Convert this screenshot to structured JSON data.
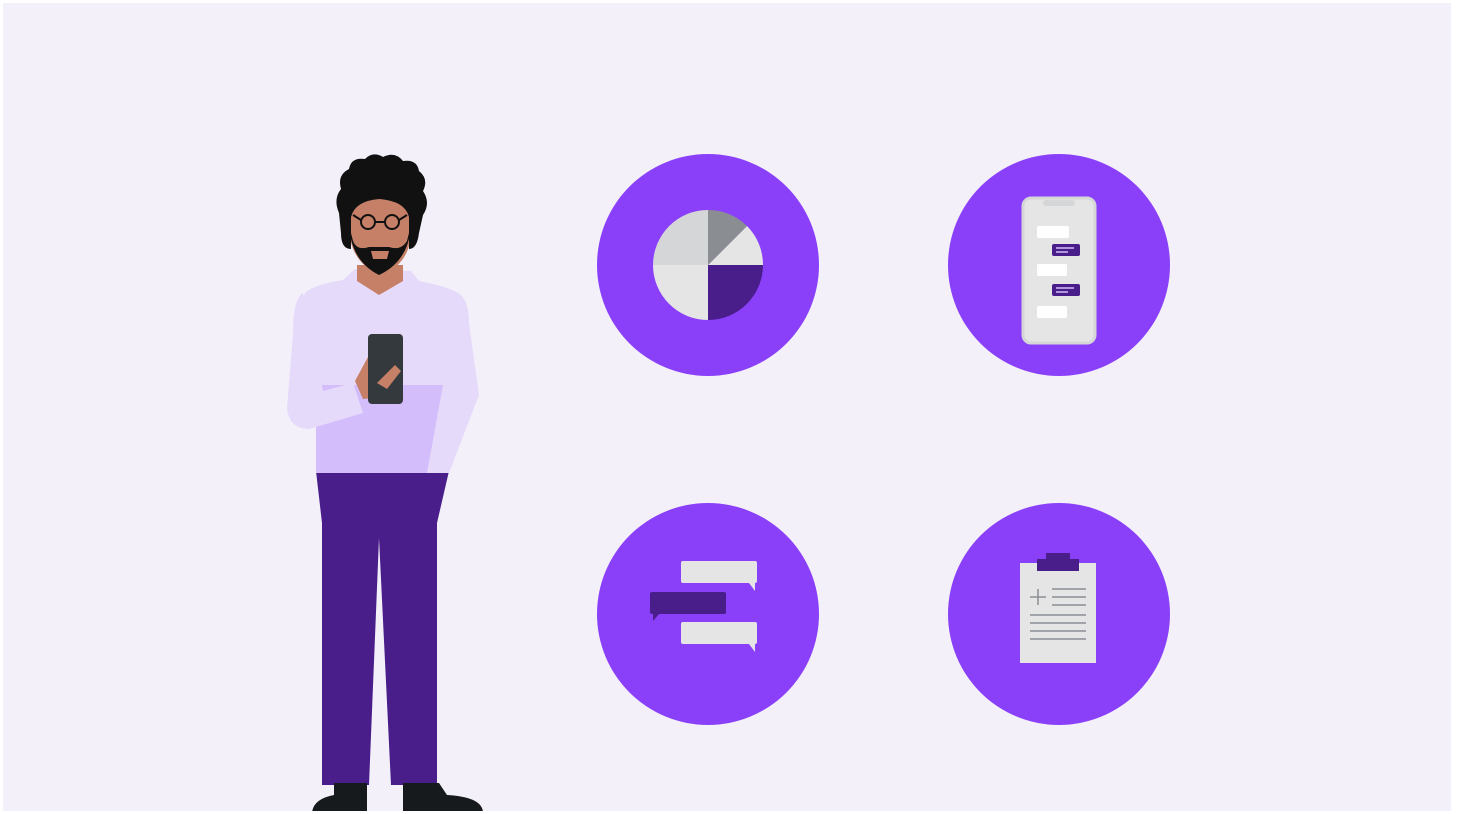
{
  "colors": {
    "background": "#f3f0fa",
    "accent_purple": "#8a40f9",
    "dark_purple": "#491e8b",
    "shirt_light": "#e6dafb",
    "shirt_shade": "#d4bdfb",
    "skin": "#c58067",
    "hair": "#111111",
    "phone": "#34393d",
    "gray_light": "#e5e5e6",
    "gray_mid": "#d5d6d7",
    "gray_dark": "#8a8e93",
    "white": "#ffffff",
    "shoe": "#161a1c"
  },
  "illustration": {
    "person": "person-with-phone",
    "icons": [
      "pie-chart-icon",
      "phone-chat-icon",
      "chat-bubbles-icon",
      "clipboard-icon"
    ]
  }
}
